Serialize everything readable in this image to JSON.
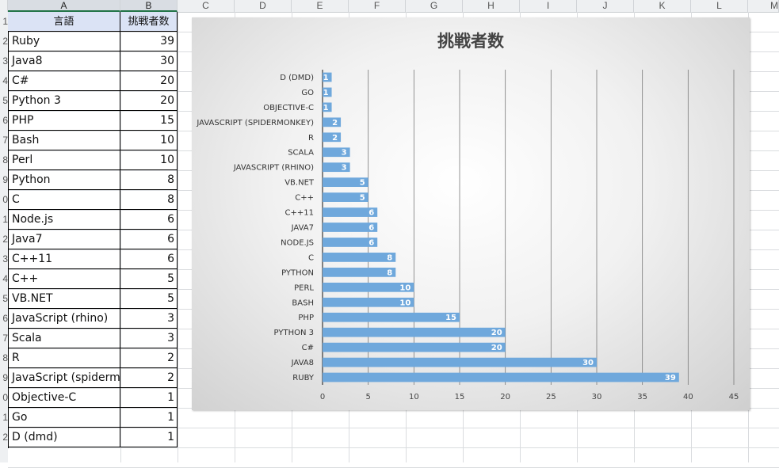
{
  "spreadsheet": {
    "columns": [
      "A",
      "B",
      "C",
      "D",
      "E",
      "F",
      "G",
      "H",
      "I",
      "J",
      "K",
      "L",
      "M"
    ],
    "row_numbers": [
      "1",
      "2",
      "3",
      "4",
      "5",
      "6",
      "7",
      "8",
      "9",
      "0",
      "1",
      "2",
      "3",
      "4",
      "5",
      "6",
      "7",
      "8",
      "9",
      "0",
      "1",
      "2"
    ],
    "header": {
      "language": "言語",
      "count": "挑戦者数"
    },
    "rows": [
      {
        "language": "Ruby",
        "count": "39"
      },
      {
        "language": "Java8",
        "count": "30"
      },
      {
        "language": "C#",
        "count": "20"
      },
      {
        "language": "Python 3",
        "count": "20"
      },
      {
        "language": "PHP",
        "count": "15"
      },
      {
        "language": "Bash",
        "count": "10"
      },
      {
        "language": "Perl",
        "count": "10"
      },
      {
        "language": "Python",
        "count": "8"
      },
      {
        "language": "C",
        "count": "8"
      },
      {
        "language": "Node.js",
        "count": "6"
      },
      {
        "language": "Java7",
        "count": "6"
      },
      {
        "language": "C++11",
        "count": "6"
      },
      {
        "language": "C++",
        "count": "5"
      },
      {
        "language": "VB.NET",
        "count": "5"
      },
      {
        "language": "JavaScript (rhino)",
        "count": "3"
      },
      {
        "language": "Scala",
        "count": "3"
      },
      {
        "language": "R",
        "count": "2"
      },
      {
        "language": "JavaScript (spidermonkey)",
        "count": "2"
      },
      {
        "language": "Objective-C",
        "count": "1"
      },
      {
        "language": "Go",
        "count": "1"
      },
      {
        "language": "D (dmd)",
        "count": "1"
      }
    ]
  },
  "chart_data": {
    "type": "bar",
    "orientation": "horizontal",
    "title": "挑戦者数",
    "categories": [
      "D (DMD)",
      "GO",
      "OBJECTIVE-C",
      "JAVASCRIPT (SPIDERMONKEY)",
      "R",
      "SCALA",
      "JAVASCRIPT (RHINO)",
      "VB.NET",
      "C++",
      "C++11",
      "JAVA7",
      "NODE.JS",
      "C",
      "PYTHON",
      "PERL",
      "BASH",
      "PHP",
      "PYTHON 3",
      "C#",
      "JAVA8",
      "RUBY"
    ],
    "values": [
      1,
      1,
      1,
      2,
      2,
      3,
      3,
      5,
      5,
      6,
      6,
      6,
      8,
      8,
      10,
      10,
      15,
      20,
      20,
      30,
      39
    ],
    "data_labels": [
      "1",
      "1",
      "1",
      "2",
      "2",
      "3",
      "3",
      "5",
      "5",
      "6",
      "6",
      "6",
      "8",
      "8",
      "10",
      "10",
      "15",
      "20",
      "20",
      "30",
      "39"
    ],
    "xlim": [
      0,
      45
    ],
    "x_ticks": [
      "0",
      "5",
      "10",
      "15",
      "20",
      "25",
      "30",
      "35",
      "40",
      "45"
    ],
    "grid": "vertical",
    "bar_color": "#6fa8dc"
  }
}
